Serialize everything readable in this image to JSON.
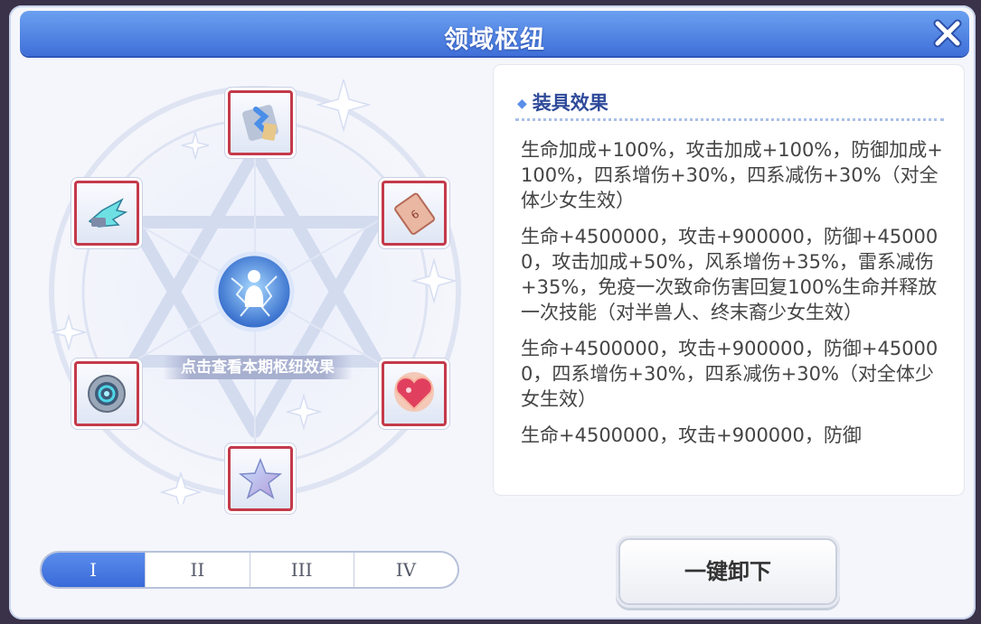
{
  "dialog": {
    "title": "领域枢纽",
    "close_icon": "close-icon"
  },
  "emblem": {
    "core_icon": "lightning-figure-icon",
    "core_label": "点击查看本期枢纽效果",
    "slots": [
      {
        "icon": "puzzle-piece-icon"
      },
      {
        "icon": "card-icon"
      },
      {
        "icon": "heart-gem-icon"
      },
      {
        "icon": "star-crystal-icon"
      },
      {
        "icon": "shield-disc-icon"
      },
      {
        "icon": "wing-icon"
      }
    ],
    "frame_color": "#c43a4a"
  },
  "tabs": {
    "items": [
      "I",
      "II",
      "III",
      "IV"
    ],
    "active_index": 0
  },
  "panel": {
    "header": "装具效果",
    "effects": [
      "生命加成+100%，攻击加成+100%，防御加成+100%，四系增伤+30%，四系减伤+30%（对全体少女生效）",
      "生命+4500000，攻击+900000，防御+450000，攻击加成+50%，风系增伤+35%，雷系减伤+35%，免疫一次致命伤害回复100%生命并释放一次技能（对半兽人、终末裔少女生效）",
      "生命+4500000，攻击+900000，防御+450000，四系增伤+30%，四系减伤+30%（对全体少女生效）",
      "生命+4500000，攻击+900000，防御"
    ]
  },
  "actions": {
    "unequip_all_label": "一键卸下"
  },
  "colors": {
    "title_bar": "#4a7ee0",
    "accent": "#2f4a9a"
  }
}
